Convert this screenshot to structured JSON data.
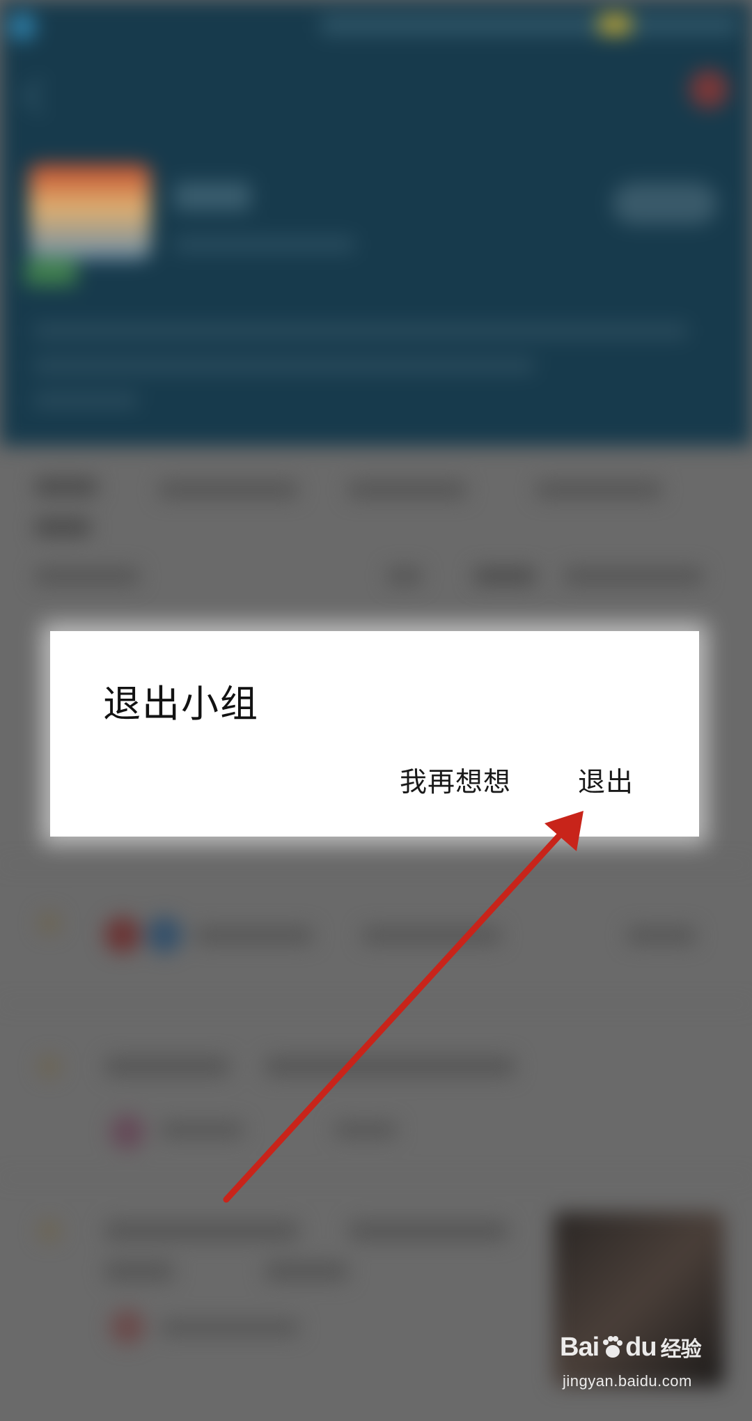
{
  "dialog": {
    "title": "退出小组",
    "cancel_label": "我再想想",
    "confirm_label": "退出"
  },
  "watermark": {
    "logo_text_left": "Bai",
    "logo_text_right": "du",
    "logo_cn": "经验",
    "url": "jingyan.baidu.com"
  },
  "colors": {
    "arrow": "#c8241a",
    "header_bg": "#173a4c",
    "overlay_bg": "#6a6a6a"
  }
}
